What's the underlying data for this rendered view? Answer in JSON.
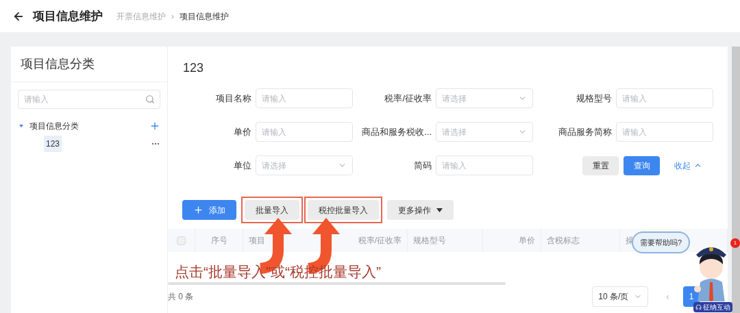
{
  "header": {
    "title": "项目信息维护",
    "breadcrumb_separator": "›",
    "breadcrumb": [
      {
        "label": "开票信息维护",
        "current": false
      },
      {
        "label": "项目信息维护",
        "current": true
      }
    ]
  },
  "sidebar": {
    "title": "项目信息分类",
    "search": {
      "placeholder": "请输入"
    },
    "tree": [
      {
        "label": "项目信息分类",
        "expanded": true,
        "children": [
          {
            "label": "123",
            "selected": true
          }
        ]
      }
    ]
  },
  "main": {
    "title": "123",
    "filters": [
      {
        "label": "项目名称",
        "kind": "input",
        "placeholder": "请输入"
      },
      {
        "label": "税率/征收率",
        "kind": "select",
        "placeholder": "请选择"
      },
      {
        "label": "规格型号",
        "kind": "input",
        "placeholder": "请输入"
      },
      {
        "label": "单价",
        "kind": "input",
        "placeholder": "请输入"
      },
      {
        "label": "商品和服务税收...",
        "kind": "select",
        "placeholder": "请选择"
      },
      {
        "label": "商品服务简称",
        "kind": "input",
        "placeholder": "请输入"
      },
      {
        "label": "单位",
        "kind": "select",
        "placeholder": "请选择"
      },
      {
        "label": "简码",
        "kind": "input",
        "placeholder": "请输入"
      }
    ],
    "reset": "重置",
    "query": "查询",
    "collapse": "收起",
    "toolbar": [
      {
        "label": "添加",
        "kind": "primary",
        "highlighted": false
      },
      {
        "label": "批量导入",
        "kind": "default",
        "highlighted": true
      },
      {
        "label": "税控批量导入",
        "kind": "default",
        "highlighted": true
      },
      {
        "label": "更多操作",
        "kind": "dropdown",
        "highlighted": false
      }
    ],
    "table": {
      "select_all": {
        "checked": false
      },
      "columns": [
        {
          "label": "序号"
        },
        {
          "label": "项目"
        },
        {
          "label": "税率/征收率"
        },
        {
          "label": "规格型号"
        },
        {
          "label": "单价"
        },
        {
          "label": "含税标志"
        },
        {
          "label": "操"
        }
      ]
    },
    "total": "共 0 条",
    "pagination": {
      "page_size": "10 条/页",
      "prev": "‹",
      "pages": [
        {
          "label": "1",
          "selected": true
        }
      ]
    }
  },
  "annotation": {
    "text": "点击“批量导入”或“税控批量导入”"
  },
  "help": {
    "bubble": "需要帮助吗?",
    "badge": "1",
    "label": "征纳互动"
  }
}
